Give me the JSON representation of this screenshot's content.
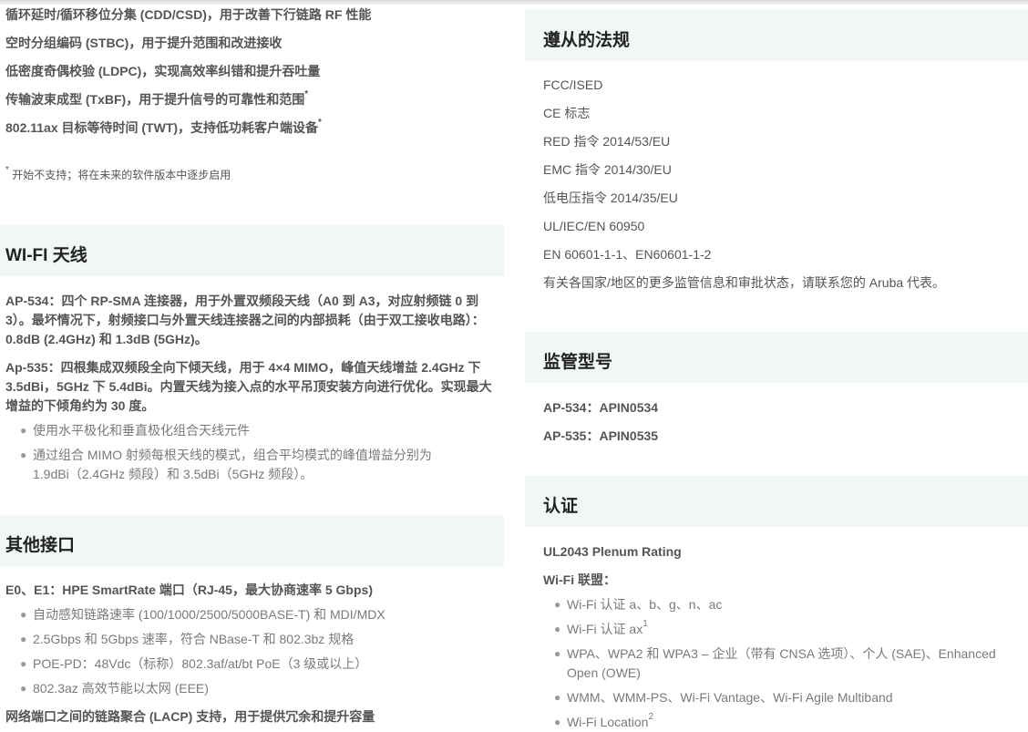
{
  "left": {
    "features": [
      {
        "text": "循环延时/循环移位分集 (CDD/CSD)，用于改善下行链路 RF 性能",
        "mark": ""
      },
      {
        "text": "空时分组编码 (STBC)，用于提升范围和改进接收",
        "mark": ""
      },
      {
        "text": "低密度奇偶校验 (LDPC)，实现高效率纠错和提升吞吐量",
        "mark": ""
      },
      {
        "text": "传输波束成型 (TxBF)，用于提升信号的可靠性和范围",
        "mark": "*"
      },
      {
        "text": "802.11ax 目标等待时间 (TWT)，支持低功耗客户端设备",
        "mark": "*"
      }
    ],
    "footnote_mark": "*",
    "footnote": "开始不支持；将在未来的软件版本中逐步启用",
    "antenna": {
      "heading": "WI-FI 天线",
      "p1": "AP-534：四个 RP-SMA 连接器，用于外置双频段天线（A0 到 A3，对应射频链 0 到 3）。最坏情况下，射频接口与外置天线连接器之间的内部损耗（由于双工接收电路）：0.8dB (2.4GHz) 和 1.3dB (5GHz)。",
      "p2": "Ap-535：四根集成双频段全向下倾天线，用于 4×4 MIMO，峰值天线增益 2.4GHz 下 3.5dBi，5GHz 下 5.4dBi。内置天线为接入点的水平吊顶安装方向进行优化。实现最大增益的下倾角约为 30 度。",
      "bullets": [
        "使用水平极化和垂直极化组合天线元件",
        "通过组合 MIMO 射频每根天线的模式，组合平均模式的峰值增益分别为 1.9dBi（2.4GHz 频段）和 3.5dBi（5GHz 频段）。"
      ]
    },
    "interfaces": {
      "heading": "其他接口",
      "e0e1": "E0、E1：HPE SmartRate 端口（RJ-45，最大协商速率 5 Gbps)",
      "bullets": [
        "自动感知链路速率 (100/1000/2500/5000BASE-T) 和 MDI/MDX",
        "2.5Gbps 和 5Gbps 速率，符合 NBase-T 和 802.3bz 规格",
        "POE-PD：48Vdc（标称）802.3af/at/bt PoE（3 级或以上）",
        "802.3az 高效节能以太网 (EEE)"
      ],
      "lacp": "网络端口之间的链路聚合 (LACP) 支持，用于提供冗余和提升容量"
    }
  },
  "right": {
    "compliance": {
      "heading": "遵从的法规",
      "items": [
        "FCC/ISED",
        "CE 标志",
        "RED 指令 2014/53/EU",
        "EMC 指令 2014/30/EU",
        "低电压指令 2014/35/EU",
        "UL/IEC/EN 60950",
        "EN 60601-1-1、EN60601-1-2"
      ],
      "note": "有关各国家/地区的更多监管信息和审批状态，请联系您的 Aruba 代表。"
    },
    "models": {
      "heading": "监管型号",
      "items": [
        "AP-534：APIN0534",
        "AP-535：APIN0535"
      ]
    },
    "certs": {
      "heading": "认证",
      "ul": "UL2043 Plenum Rating",
      "wifi_alliance": "Wi-Fi 联盟：",
      "bullets": [
        {
          "text": "Wi-Fi 认证 a、b、g、n、ac",
          "sup": ""
        },
        {
          "text": "Wi-Fi 认证 ax",
          "sup": "1"
        },
        {
          "text": "WPA、WPA2 和 WPA3 – 企业（带有 CNSA 选项）、个人 (SAE)、Enhanced Open (OWE)",
          "sup": ""
        },
        {
          "text": "WMM、WMM-PS、Wi-Fi Vantage、Wi-Fi Agile Multiband",
          "sup": ""
        },
        {
          "text": "Wi-Fi Location",
          "sup": "2"
        }
      ]
    }
  }
}
